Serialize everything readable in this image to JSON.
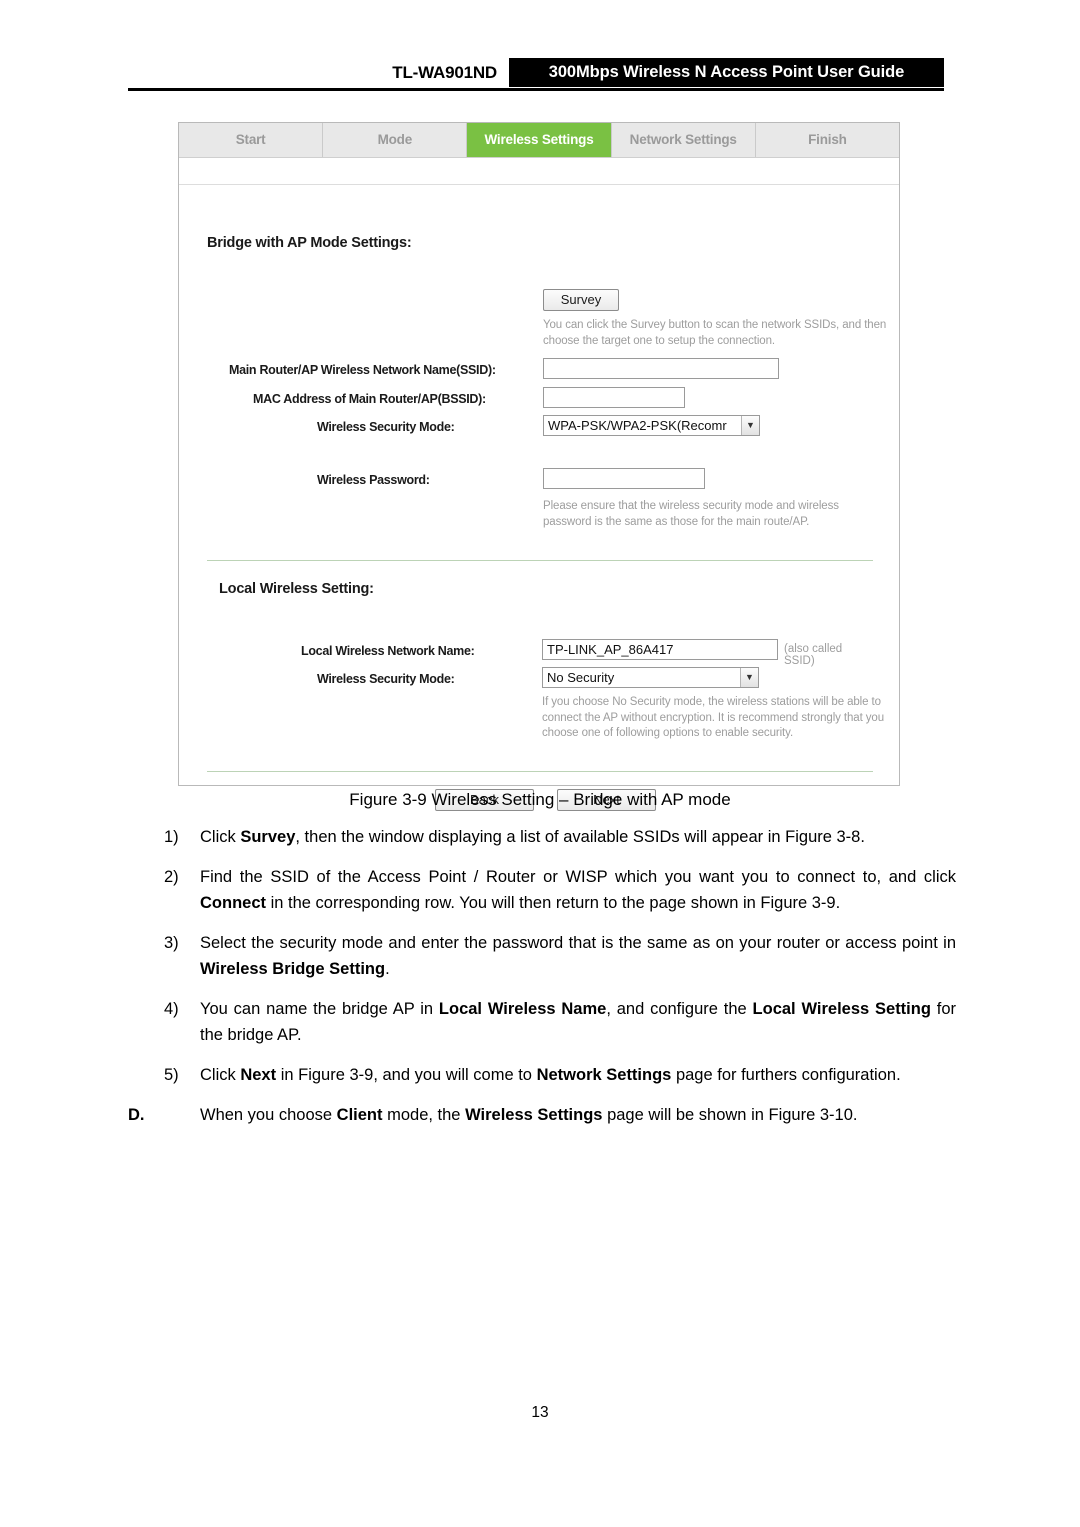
{
  "header": {
    "model": "TL-WA901ND",
    "title": "300Mbps Wireless N Access Point User Guide"
  },
  "figure": {
    "tabs": [
      {
        "label": "Start",
        "active": false
      },
      {
        "label": "Mode",
        "active": false
      },
      {
        "label": "Wireless Settings",
        "active": true
      },
      {
        "label": "Network Settings",
        "active": false
      },
      {
        "label": "Finish",
        "active": false
      }
    ],
    "bridge_section": {
      "title": "Bridge with AP Mode Settings:",
      "survey_button": "Survey",
      "survey_hint": "You can click the Survey button to scan the network SSIDs, and then choose the target one to setup the connection.",
      "ssid_label": "Main Router/AP Wireless Network Name(SSID):",
      "ssid_value": "",
      "bssid_label": "MAC Address of Main Router/AP(BSSID):",
      "bssid_value": "",
      "security_label": "Wireless Security Mode:",
      "security_value": "WPA-PSK/WPA2-PSK(Recomr",
      "password_label": "Wireless Password:",
      "password_value": "",
      "password_hint": "Please ensure that the wireless security mode and wireless password is the same as those for the main route/AP."
    },
    "local_section": {
      "title": "Local Wireless Setting:",
      "name_label": "Local Wireless Network Name:",
      "name_value": "TP-LINK_AP_86A417",
      "name_note": "(also called SSID)",
      "security_label": "Wireless Security Mode:",
      "security_value": "No Security",
      "security_hint": "If you choose No Security mode, the wireless stations will be able to connect the AP without encryption. It is recommend strongly that you choose one of following options to enable security."
    },
    "buttons": {
      "back": "Back",
      "next": "Next"
    }
  },
  "caption": "Figure 3-9 Wireless Setting – Bridge with AP mode",
  "steps": [
    {
      "marker": "1)",
      "html": "Click <b>Survey</b>, then the window displaying a list of available SSIDs will appear in Figure 3-8."
    },
    {
      "marker": "2)",
      "html": "Find the SSID of the Access Point / Router or WISP which you want you to connect to, and click <b>Connect</b> in the corresponding row. You will then return to the page shown in Figure 3-9."
    },
    {
      "marker": "3)",
      "html": "Select the security mode and enter the password that is the same as on your router or access point in <b>Wireless Bridge Setting</b>."
    },
    {
      "marker": "4)",
      "html": "You can name the bridge AP in <b>Local Wireless Name</b>, and configure the <b>Local Wireless Setting</b> for the bridge AP."
    },
    {
      "marker": "5)",
      "html": "Click <b>Next</b> in Figure 3-9, and you will come to <b>Network Settings</b> page for furthers configuration."
    },
    {
      "marker": "D.",
      "html": "When you choose <b>Client</b> mode, the <b>Wireless Settings</b> page will be shown in Figure 3-10."
    }
  ],
  "page_number": "13",
  "colors": {
    "active_tab": "#7ac143",
    "header_bar": "#000000",
    "hint_text": "#9d9d9d"
  }
}
